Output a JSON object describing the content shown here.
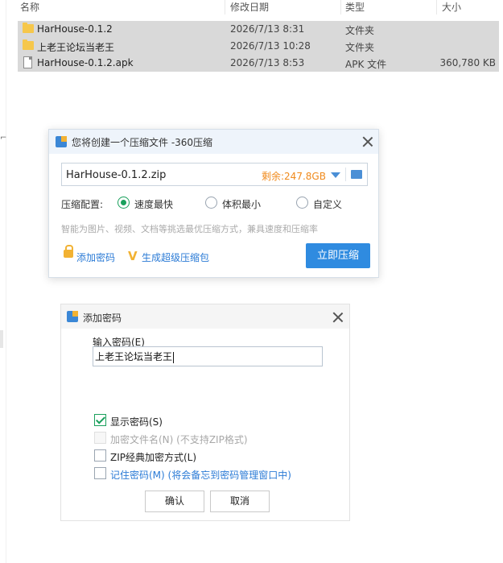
{
  "explorer": {
    "headers": {
      "name": "名称",
      "modified": "修改日期",
      "type": "类型",
      "size": "大小"
    },
    "files": [
      {
        "name": "HarHouse-0.1.2",
        "modified": "2026/7/13 8:31",
        "type": "文件夹",
        "size": "",
        "icon": "folder-icon"
      },
      {
        "name": "上老王论坛当老王",
        "modified": "2026/7/13 10:28",
        "type": "文件夹",
        "size": "",
        "icon": "folder-icon"
      },
      {
        "name": "HarHouse-0.1.2.apk",
        "modified": "2026/7/13 8:53",
        "type": "APK 文件",
        "size": "360,780 KB",
        "icon": "file-icon"
      }
    ]
  },
  "compress_dialog": {
    "title": "您将创建一个压缩文件 -360压缩",
    "filename": "HarHouse-0.1.2.zip",
    "free_space": "剩余:247.8GB",
    "config_label": "压缩配置:",
    "options": [
      {
        "label": "速度最快",
        "selected": true
      },
      {
        "label": "体积最小",
        "selected": false
      },
      {
        "label": "自定义",
        "selected": false
      }
    ],
    "hint": "智能为图片、视频、文档等挑选最优压缩方式，兼具速度和压缩率",
    "add_password": "添加密码",
    "super_pack": "生成超级压缩包",
    "compress_now": "立即压缩"
  },
  "password_dialog": {
    "title": "添加密码",
    "input_label": "输入密码(E)",
    "password_value": "上老王论坛当老王",
    "checkboxes": [
      {
        "label": "显示密码(S)",
        "checked": true,
        "enabled": true
      },
      {
        "label": "加密文件名(N) (不支持ZIP格式)",
        "checked": false,
        "enabled": false
      },
      {
        "label": "ZIP经典加密方式(L)",
        "checked": false,
        "enabled": true
      },
      {
        "label": "记住密码(M) (将会备忘到密码管理窗口中)",
        "checked": false,
        "enabled": true
      }
    ],
    "ok": "确认",
    "cancel": "取消"
  },
  "colors": {
    "accent_blue": "#2f8be0",
    "free_space_orange": "#f08a1c",
    "check_green": "#1aa05c",
    "selection_gray": "#d9d9d9"
  }
}
